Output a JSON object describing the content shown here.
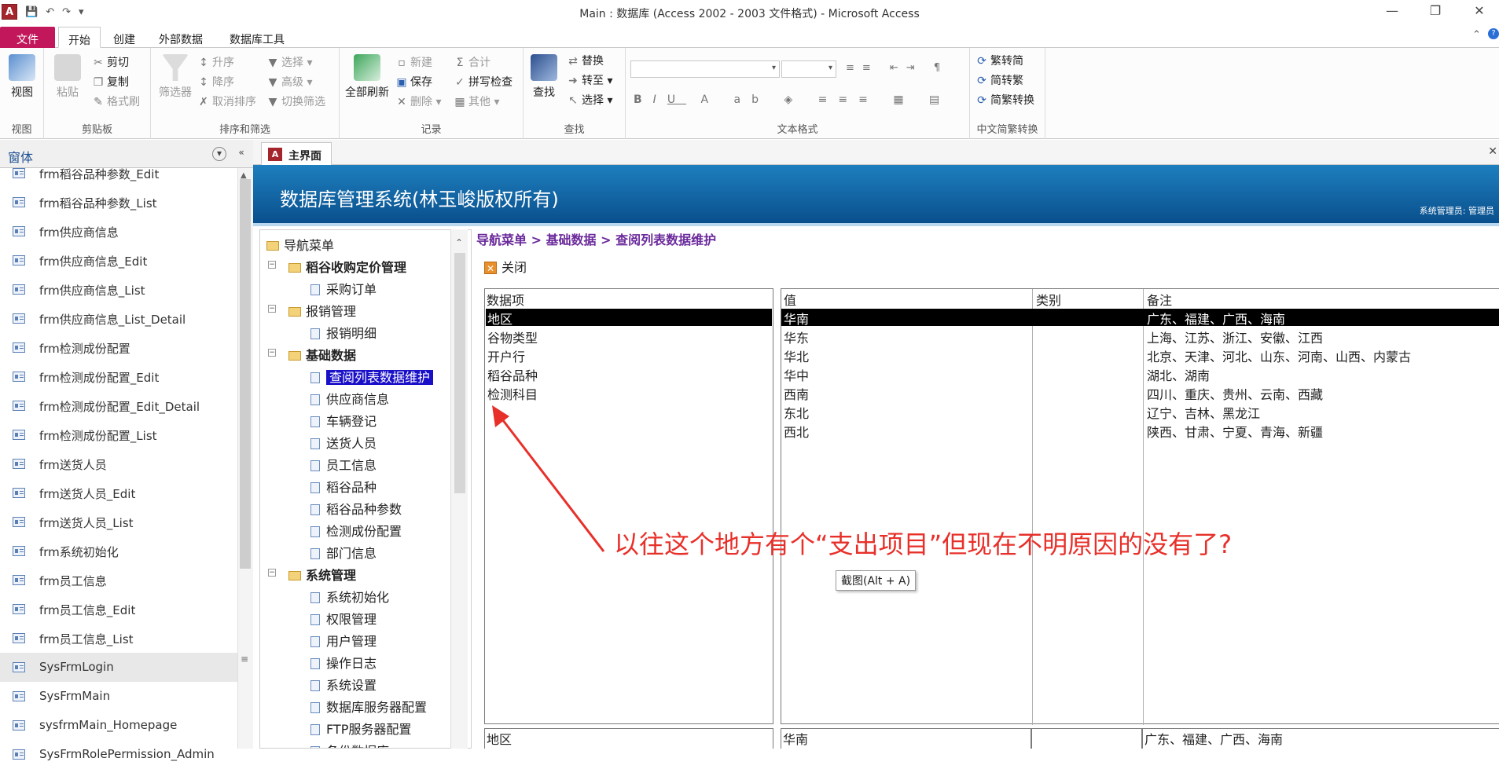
{
  "window": {
    "title": "Main : 数据库 (Access 2002 - 2003 文件格式) - Microsoft Access",
    "app_icon": "A"
  },
  "tabs": [
    "文件",
    "开始",
    "创建",
    "外部数据",
    "数据库工具"
  ],
  "ribbon": {
    "view": {
      "label": "视图",
      "group": "视图"
    },
    "clipboard": {
      "paste": "粘贴",
      "cut": "剪切",
      "copy": "复制",
      "format_painter": "格式刷",
      "group": "剪贴板"
    },
    "sort_filter": {
      "filter": "筛选器",
      "asc": "升序",
      "desc": "降序",
      "clear_sort": "取消排序",
      "select": "选择",
      "advanced": "高级",
      "toggle_filter": "切换筛选",
      "group": "排序和筛选"
    },
    "records": {
      "refresh_all": "全部刷新",
      "new": "新建",
      "save": "保存",
      "delete": "删除",
      "totals": "合计",
      "spelling": "拼写检查",
      "other": "其他",
      "group": "记录"
    },
    "find": {
      "find": "查找",
      "replace": "替换",
      "goto": "转至",
      "select": "选择",
      "group": "查找"
    },
    "text_format": {
      "group": "文本格式"
    },
    "chinese": {
      "to_trad": "繁转简",
      "to_simp": "简转繁",
      "convert": "简繁转换",
      "group": "中文简繁转换"
    }
  },
  "navpane": {
    "title": "窗体",
    "items": [
      "frm稻谷品种参数_Edit",
      "frm稻谷品种参数_List",
      "frm供应商信息",
      "frm供应商信息_Edit",
      "frm供应商信息_List",
      "frm供应商信息_List_Detail",
      "frm检测成份配置",
      "frm检测成份配置_Edit",
      "frm检测成份配置_Edit_Detail",
      "frm检测成份配置_List",
      "frm送货人员",
      "frm送货人员_Edit",
      "frm送货人员_List",
      "frm系统初始化",
      "frm员工信息",
      "frm员工信息_Edit",
      "frm员工信息_List",
      "SysFrmLogin",
      "SysFrmMain",
      "sysfrmMain_Homepage",
      "SysFrmRolePermission_Admin"
    ]
  },
  "doc_tab": {
    "title": "主界面"
  },
  "banner": {
    "title": "数据库管理系统(林玉峻版权所有)",
    "user": "系统管理员: 管理员"
  },
  "tree": {
    "root": "导航菜单",
    "g1": "稻谷收购定价管理",
    "g1_c1": "采购订单",
    "g2": "报销管理",
    "g2_c1": "报销明细",
    "g3": "基础数据",
    "g3_children": [
      "查阅列表数据维护",
      "供应商信息",
      "车辆登记",
      "送货人员",
      "员工信息",
      "稻谷品种",
      "稻谷品种参数",
      "检测成份配置",
      "部门信息"
    ],
    "g4": "系统管理",
    "g4_children": [
      "系统初始化",
      "权限管理",
      "用户管理",
      "操作日志",
      "系统设置",
      "数据库服务器配置",
      "FTP服务器配置",
      "备份数据库"
    ]
  },
  "breadcrumb": "导航菜单 > 基础数据 > 查阅列表数据维护",
  "close_label": "关闭",
  "data_items": {
    "header": "数据项",
    "items": [
      "地区",
      "谷物类型",
      "开户行",
      "稻谷品种",
      "检测科目"
    ]
  },
  "values_table": {
    "headers": [
      "值",
      "类别",
      "备注"
    ],
    "rows": [
      [
        "华南",
        "",
        "广东、福建、广西、海南"
      ],
      [
        "华东",
        "",
        "上海、江苏、浙江、安徽、江西"
      ],
      [
        "华北",
        "",
        "北京、天津、河北、山东、河南、山西、内蒙古"
      ],
      [
        "华中",
        "",
        "湖北、湖南"
      ],
      [
        "西南",
        "",
        "四川、重庆、贵州、云南、西藏"
      ],
      [
        "东北",
        "",
        "辽宁、吉林、黑龙江"
      ],
      [
        "西北",
        "",
        "陕西、甘肃、宁夏、青海、新疆"
      ]
    ]
  },
  "bottom": {
    "item": "地区",
    "value": "华南",
    "note": "广东、福建、广西、海南"
  },
  "annotation": "以往这个地方有个“支出项目”但现在不明原因的没有了?",
  "tooltip": "截图(Alt + A)",
  "colors": {
    "file_tab": "#c2185b",
    "banner": "#0a4f8d",
    "selected_tree": "#1a10c8",
    "annotation": "#e8302a",
    "breadcrumb": "#6a2a9b"
  }
}
